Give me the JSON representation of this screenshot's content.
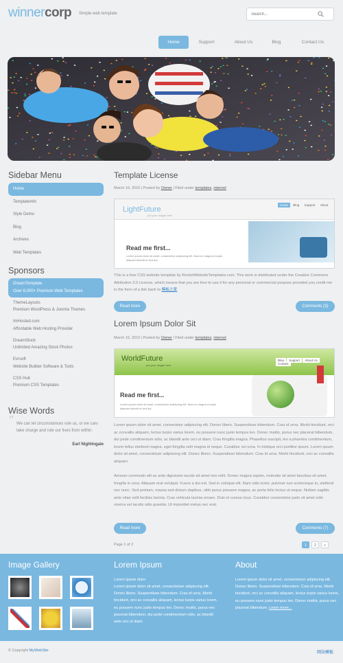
{
  "brand": {
    "logo_part1": "winner",
    "logo_part2": "corp",
    "tagline": "Simple web template"
  },
  "search": {
    "placeholder": "Search..."
  },
  "nav": {
    "items": [
      "Home",
      "Support",
      "About Us",
      "Blog",
      "Contact Us"
    ]
  },
  "sidebar": {
    "menu_title": "Sidebar Menu",
    "menu_items": [
      "Home",
      "Templateinfo",
      "Style Demo",
      "Blog",
      "Archives",
      "Web Templates"
    ],
    "sponsors_title": "Sponsors",
    "sponsors": [
      {
        "name": "DreamTemplate",
        "desc": "Over 6,000+ Premium Web Templates"
      },
      {
        "name": "ThemeLayouts",
        "desc": "Premium WordPress & Joomla Themes"
      },
      {
        "name": "ImHosted.com",
        "desc": "Affordable Web Hosting Provider"
      },
      {
        "name": "DreamStock",
        "desc": "Unlimited Amazing Stock Photos"
      },
      {
        "name": "Evrsoft",
        "desc": "Website Builder Software & Tools"
      },
      {
        "name": "CSS Hub",
        "desc": "Premium CSS Templates"
      }
    ],
    "wise_title": "Wise Words",
    "quote": "We can let circumstances rule us, or we can take charge and rule our lives from within.",
    "quote_author": "Earl Nightingale"
  },
  "posts": [
    {
      "title": "Template License",
      "meta": {
        "date": "March 16, 2010",
        "sep1": "|",
        "posted_by": "Posted by",
        "author": "Owner",
        "sep2": "|",
        "filed": "Filed under",
        "tag1": "templates",
        "comma": ",",
        "tag2": "internet"
      },
      "shot": {
        "brand": "LightFuture",
        "slogan": "put your slogan here",
        "nav": [
          "Home",
          "Blog",
          "Support",
          "About"
        ],
        "heading": "Read me first...",
        "line1": "Lorem ipsum dolor sit amet, consectetur adipiscing elit. Nam eu magna a turpis",
        "line2": "aliquam blandit ut sed dui."
      },
      "body": "This is a free CSS website template by RocketWebsiteTemplates.com. This work is distributed under the Creative Commons Attribution 3.0 License, which means that you are free to use it for any personal or commercial purpose provided you credit me in the form of a link back to",
      "body_link": "模板之家",
      "read_more": "Read more",
      "comments": "Comments (3)"
    },
    {
      "title": "Lorem Ipsum Dolor Sit",
      "meta": {
        "date": "March 16, 2010",
        "sep1": "|",
        "posted_by": "Posted by",
        "author": "Owner",
        "sep2": "|",
        "filed": "Filed under",
        "tag1": "templates",
        "comma": ",",
        "tag2": "internet"
      },
      "shot": {
        "brand": "WorldFuture",
        "slogan": "put your slogan here",
        "nav": [
          "Blog",
          "Support",
          "About Us",
          "Contact"
        ],
        "heading": "Read me first...",
        "line1": "Lorem ipsum dolor sit amet, consectetur adipiscing elit. Nam eu magna a turpis",
        "line2": "aliquam blandit ut sed dui."
      },
      "para1": "Lorem ipsum dolor sit amet, consectetur adipiscing elit. Donec libero. Suspendisse bibendum. Cras id urna. Morbi tincidunt, orci ac convallis aliquam, lectus turpis varius lorem, eu posuere nunc justo tempus leo. Donec mattis, purus nec placerat bibendum, dui pede condimentum odio, ac blandit ante orci ut diam. Cras fringilla magna. Phasellus suscipit, leo a pharetra condimentum, lorem tellus eleifend magna, eget fringilla velit magna id neque. Curabitur vel urna. In tristique orci porttitor ipsum. Lorem ipsum dolor sit amet, consectetuer adipiscing elit. Donec libero. Suspendisse bibendum. Cras id urna. Morbi tincidunt, orci ac convallis aliquam.",
      "para2": "Aenean commodo elit ac ante dignissim iaculis sit amet non velit. Donec magna sapien, molestie sit amet faucibus sit amet, fringilla in urna. Aliquam erat volutpat. Fusce a dui est. Sed in volutpat elit. Nam odio tortor, pulvinar non scelerisque in, eleifend nec nunc. Sed pretium, massa sed dictum dapibus, nibh purus posuere magna, ac porta felis lectus ut neque. Nullam sagittis ante vitae velit facilisis lacinia. Cras vehicula lacinia ornare. Duis et cursus risus. Curabitur consectetur justo sit amet odio viverra vel iaculis odio gravida. Ut imperdiet metus nec erat.",
      "read_more": "Read more",
      "comments": "Comments (7)"
    }
  ],
  "pagination": {
    "label": "Page 1 of 2",
    "pages": [
      "1",
      "2",
      "»"
    ]
  },
  "footer": {
    "gallery_title": "Image Gallery",
    "lorem_title": "Lorem Ipsum",
    "lorem_sub": "Lorem ipsum dolor",
    "lorem_text": "Lorem ipsum dolor sit amet, consectetuer adipiscing elit. Donec libero. Suspendisse bibendum. Cras id urna. Morbi tincidunt, orci ac convallis aliquam, lectus turpis varius lorem, eu posuere nunc justo tempus leo. Donec mattis, purus nec placerat bibendum, dui pede condimentum odio, ac blandit ante orci ut diam.",
    "about_title": "About",
    "about_text": "Lorem ipsum dolor sit amet, consectetuer adipiscing elit. Donec libero. Suspendisse bibendum. Cras id urna. Morbi tincidunt, orci ac convallis aliquam, lectus turpis varius lorem, eu posuere nunc justo tempus leo. Donec mattis, purus nec placerat bibendum,",
    "about_link": "Learn more...",
    "copyright_prefix": "© Copyright",
    "copyright_link": "MyWebSite",
    "right_link": "网站模板"
  },
  "colors": {
    "accent": "#7ab8e0",
    "link": "#3b82c4",
    "page_bg": "#eef0f2"
  }
}
